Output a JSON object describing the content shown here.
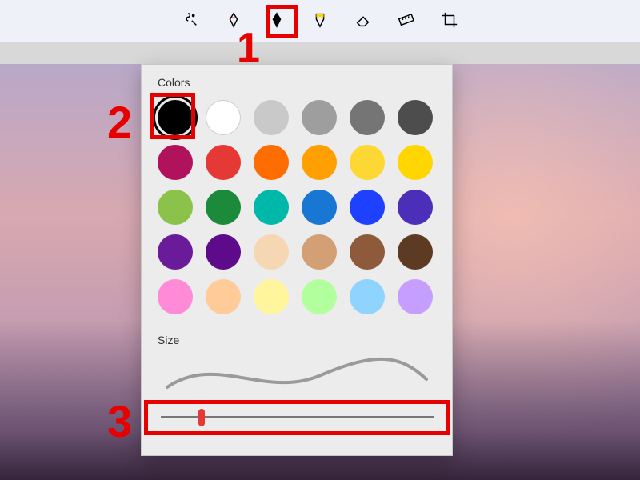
{
  "toolbar": {
    "tools": [
      {
        "name": "touch-writing-icon"
      },
      {
        "name": "ballpoint-pen-icon",
        "accent": "#e53935"
      },
      {
        "name": "pencil-icon"
      },
      {
        "name": "highlighter-icon",
        "accent": "#ffd600"
      },
      {
        "name": "eraser-icon"
      },
      {
        "name": "ruler-icon"
      },
      {
        "name": "crop-icon"
      }
    ],
    "selected_index": 2
  },
  "panel": {
    "colors_label": "Colors",
    "size_label": "Size",
    "selected_color_index": 0,
    "colors": [
      "#000000",
      "#ffffff",
      "#c9c9c9",
      "#9e9e9e",
      "#757575",
      "#4d4d4d",
      "#b0125b",
      "#e53935",
      "#ff6d00",
      "#ffa000",
      "#fdd835",
      "#ffd600",
      "#8bc34a",
      "#1b8a3a",
      "#00b8a9",
      "#1976d2",
      "#1e40ff",
      "#4b2fb8",
      "#6a1b9a",
      "#5e0b8b",
      "#f5d7b3",
      "#d2a074",
      "#8d5a3c",
      "#5d3a22",
      "#ff8ad8",
      "#ffcc99",
      "#fff59d",
      "#b2ff9e",
      "#8fd3ff",
      "#c69eff"
    ],
    "slider": {
      "min": 0,
      "max": 100,
      "value": 15
    }
  },
  "annotations": {
    "n1": "1",
    "n2": "2",
    "n3": "3"
  }
}
